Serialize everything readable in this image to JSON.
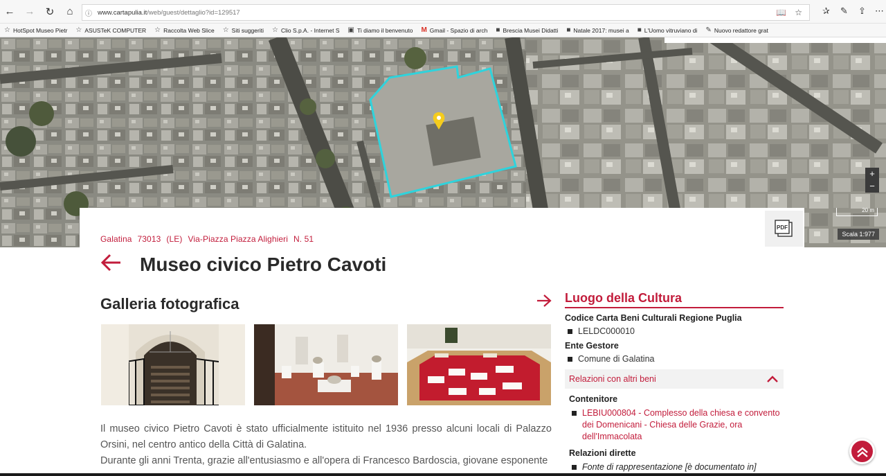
{
  "browser": {
    "url_host": "www.cartapulia.it",
    "url_path": "/web/guest/dettaglio?id=129517",
    "bookmarks": [
      {
        "label": "HotSpot Museo Pietr",
        "icon": "star-icon"
      },
      {
        "label": "ASUSTeK COMPUTER",
        "icon": "star-icon"
      },
      {
        "label": "Raccolta Web Slice",
        "icon": "star-icon"
      },
      {
        "label": "Siti suggeriti",
        "icon": "star-icon"
      },
      {
        "label": "Clio S.p.A. - Internet S",
        "icon": "star-icon"
      },
      {
        "label": "Ti diamo il benvenuto",
        "icon": "doc-icon"
      },
      {
        "label": "Gmail - Spazio di arch",
        "icon": "gmail-icon"
      },
      {
        "label": "Brescia Musei Didatti",
        "icon": "site-icon"
      },
      {
        "label": "Natale 2017: musei a",
        "icon": "site-icon"
      },
      {
        "label": "L'Uomo vitruviano di",
        "icon": "site-icon"
      },
      {
        "label": "Nuovo redattore grat",
        "icon": "pen-icon"
      }
    ]
  },
  "map": {
    "zoom_in": "+",
    "zoom_out": "−",
    "scale_label": "20 m",
    "scale_ratio": "Scala 1:977"
  },
  "header": {
    "city": "Galatina",
    "cap": "73013",
    "province": "(LE)",
    "street": "Via-Piazza Piazza Alighieri",
    "number": "N. 51",
    "pdf_label": "PDF",
    "title": "Museo civico Pietro Cavoti"
  },
  "gallery": {
    "title": "Galleria fotografica"
  },
  "description": {
    "p1": "Il museo civico Pietro Cavoti è stato ufficialmente istituito nel 1936 presso alcuni locali di Palazzo Orsini, nel centro antico della Città di Galatina.",
    "p2": "Durante gli anni Trenta, grazie all'entusiasmo e all'opera di Francesco Bardoscia, giovane esponente"
  },
  "sidebar": {
    "title": "Luogo della Cultura",
    "code_label": "Codice Carta Beni Culturali Regione Puglia",
    "code_value": "LELDC000010",
    "ente_label": "Ente Gestore",
    "ente_value": "Comune di Galatina",
    "relations_label": "Relazioni con altri beni",
    "contenitore_label": "Contenitore",
    "contenitore_value": "LEBIU000804 - Complesso della chiesa e convento dei Domenicani - Chiesa delle Grazie, ora dell'Immacolata",
    "dirette_label": "Relazioni dirette",
    "dirette_value": "Fonte di rappresentazione [è documentato in]"
  },
  "colors": {
    "accent": "#c21c3b",
    "polygon": "#2fd3dc"
  }
}
